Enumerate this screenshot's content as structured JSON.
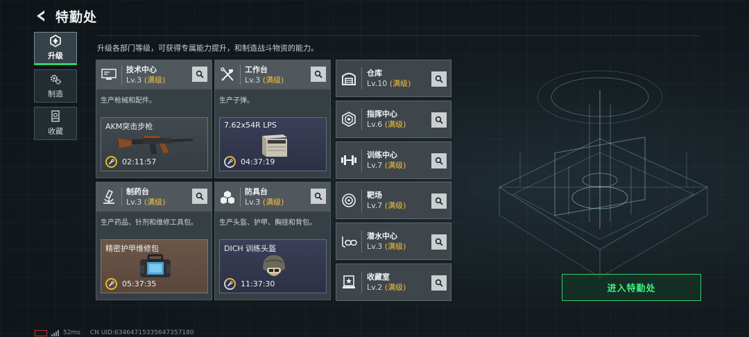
{
  "header": {
    "title": "特勤处"
  },
  "subtitle": "升级各部门等级，可获得专属能力提升，和制造战斗物资的能力。",
  "side_nav": [
    {
      "label": "升级",
      "icon": "upgrade-icon",
      "active": true
    },
    {
      "label": "制造",
      "icon": "gears-icon",
      "active": false
    },
    {
      "label": "收藏",
      "icon": "collection-icon",
      "active": false
    }
  ],
  "maxed_label": "(满级)",
  "workshops": [
    {
      "name": "技术中心",
      "level": "Lv.3",
      "desc": "生产枪械和配件。",
      "product": "AKM突击步枪",
      "timer": "02:11:57",
      "icon": "monitor-icon",
      "product_icon": "rifle-icon"
    },
    {
      "name": "工作台",
      "level": "Lv.3",
      "desc": "生产子弹。",
      "product": "7.62x54R LPS",
      "timer": "04:37:19",
      "icon": "tools-icon",
      "product_icon": "ammo-box-icon"
    },
    {
      "name": "制药台",
      "level": "Lv.3",
      "desc": "生产药品、针剂和维修工具包。",
      "product": "精密护甲维修包",
      "timer": "05:37:35",
      "icon": "microscope-icon",
      "product_icon": "repair-kit-icon"
    },
    {
      "name": "防具台",
      "level": "Lv.3",
      "desc": "生产头盔、护甲、胸挂和背包。",
      "product": "DICH 训练头盔",
      "timer": "11:37:30",
      "icon": "boxes-icon",
      "product_icon": "helmet-icon"
    }
  ],
  "facilities": [
    {
      "name": "仓库",
      "level": "Lv.10",
      "icon": "warehouse-icon"
    },
    {
      "name": "指挥中心",
      "level": "Lv.6",
      "icon": "command-icon"
    },
    {
      "name": "训练中心",
      "level": "Lv.7",
      "icon": "dumbbell-icon"
    },
    {
      "name": "靶场",
      "level": "Lv.7",
      "icon": "target-icon"
    },
    {
      "name": "潜水中心",
      "level": "Lv.3",
      "icon": "diving-mask-icon"
    },
    {
      "name": "收藏室",
      "level": "Lv.2",
      "icon": "display-case-icon"
    }
  ],
  "enter_button": "进入特勤处",
  "status": {
    "ping": "52ms",
    "uid": "CN UID:6346471533564735718​0"
  },
  "colors": {
    "accent": "#2fd06a",
    "maxed": "#f0c040",
    "battery": "#c43434"
  }
}
